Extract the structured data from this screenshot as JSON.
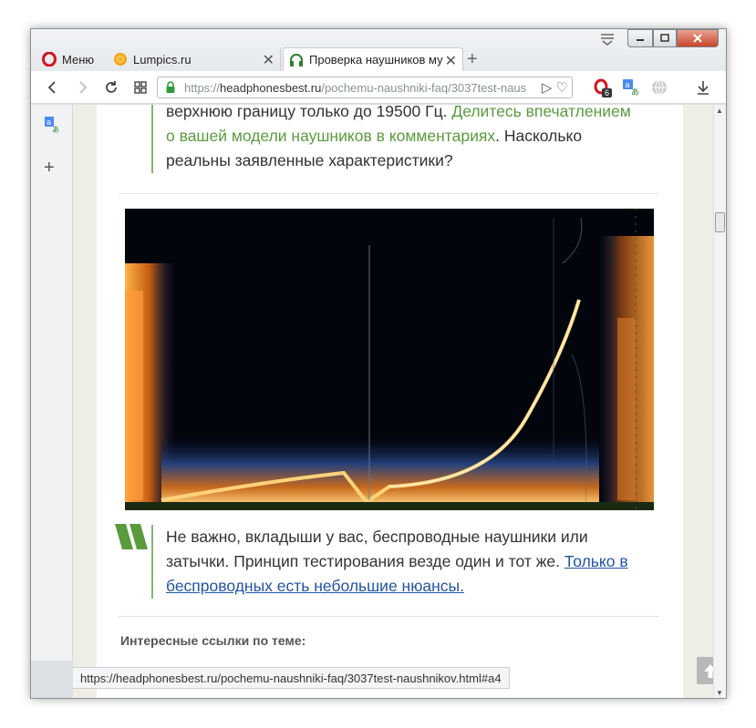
{
  "browser": {
    "tabs": [
      {
        "label": "Меню",
        "icon": "opera-logo-icon"
      },
      {
        "label": "Lumpics.ru",
        "icon": "orange-slice-icon"
      },
      {
        "label": "Проверка наушников му",
        "icon": "headphones-icon",
        "active": true
      }
    ],
    "address": {
      "protocol": "https://",
      "host": "headphonesbest.ru",
      "path": "/pochemu-naushniki-faq/3037test-naus"
    },
    "extension_badge": "6",
    "status_url": "https://headphonesbest.ru/pochemu-naushniki-faq/3037test-naushnikov.html#a4"
  },
  "article": {
    "quote1": {
      "line1": "верхнюю границу только до 19500 Гц.",
      "link_line1": "Делитесь впечатлением",
      "link_line2": "о вашей модели наушников в комментариях",
      "line2_tail": ". Насколько",
      "line3": "реальны заявленные характеристики?"
    },
    "quote2": {
      "line1": "Не важно, вкладыши у вас, беспроводные наушники или",
      "line2": "затычки. Принцип тестирования везде один и тот же.",
      "link_line2": "Только в",
      "link_line3": "беспроводных есть небольшие нюансы."
    },
    "links_heading": "Интересные ссылки по теме:"
  },
  "colors": {
    "accent_green": "#5a9b3e",
    "link_blue": "#2255a4",
    "quote_border": "#8ab278"
  }
}
